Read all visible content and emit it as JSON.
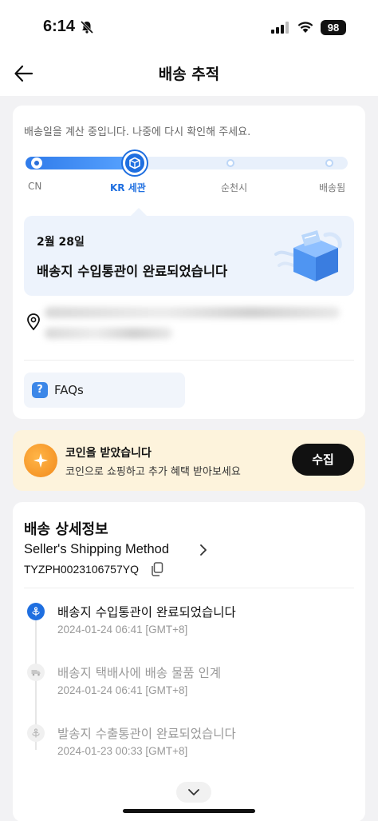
{
  "status_bar": {
    "time": "6:14",
    "battery": "98",
    "icons": [
      "bell-off-icon",
      "signal-icon",
      "wifi-icon",
      "battery-icon"
    ]
  },
  "nav": {
    "title": "배송 추적",
    "back_icon": "arrow-left-icon"
  },
  "progress": {
    "calculating_text": "배송일을 계산 중입니다. 나중에 다시 확인해 주세요.",
    "fill_fraction": 0.33,
    "steps": [
      {
        "label": "CN",
        "active": false
      },
      {
        "label": "KR 세관",
        "active": true
      },
      {
        "label": "순천시",
        "active": false
      },
      {
        "label": "배송됨",
        "active": false
      }
    ]
  },
  "latest": {
    "date": "2월 28일",
    "message": "배송지 수입통관이 완료되었습니다"
  },
  "faq": {
    "label": "FAQs"
  },
  "coin": {
    "title": "코인을 받았습니다",
    "subtitle": "코인으로 쇼핑하고 추가 혜택 받아보세요",
    "button": "수집"
  },
  "detail": {
    "heading": "배송 상세정보",
    "method": "Seller's Shipping Method",
    "tracking_number": "TYZPH0023106757YQ",
    "events": [
      {
        "title": "배송지 수입통관이 완료되었습니다",
        "time": "2024-01-24 06:41 [GMT+8]",
        "active": true,
        "icon": "customs-icon"
      },
      {
        "title": "배송지 택배사에 배송 물품 인계",
        "time": "2024-01-24 06:41 [GMT+8]",
        "active": false,
        "icon": "truck-icon"
      },
      {
        "title": "발송지 수출통관이 완료되었습니다",
        "time": "2024-01-23 00:33 [GMT+8]",
        "active": false,
        "icon": "anchor-icon"
      }
    ]
  },
  "colors": {
    "accent": "#1f6fe0",
    "coin_banner": "#fdf3dc",
    "coin": "#f28a1c"
  }
}
